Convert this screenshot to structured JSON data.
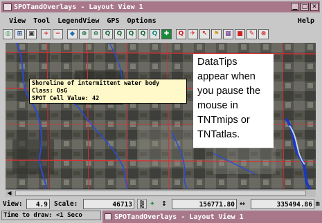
{
  "window": {
    "title": "SPOTandOverlays - Layout View 1",
    "controls": [
      "minimize",
      "maximize",
      "close"
    ]
  },
  "menu": {
    "items": [
      "View",
      "Tool",
      "LegendView",
      "GPS",
      "Options"
    ],
    "help": "Help"
  },
  "toolbar": {
    "buttons": [
      "zoom-box-icon",
      "full-extent-icon",
      "overview-icon",
      "add-layer-icon",
      "remove-layer-icon",
      "select-icon",
      "zoom-in-icon",
      "zoom-out-icon",
      "zoom-box-icon",
      "zoom-1x-icon",
      "pan-icon",
      "redraw-icon",
      "datatip-icon",
      "measure-icon",
      "gps-icon",
      "draw-icon",
      "flag-icon",
      "legend-icon",
      "layer-control-icon",
      "tool-icon"
    ]
  },
  "datatip": {
    "line1": "Shoreline of intermittent water body",
    "line2": "Class: OsG",
    "line3": "SPOT Cell Value: 42"
  },
  "annotation": {
    "text": "DataTips appear when you pause the mouse in TNTmips or TNTatlas."
  },
  "status": {
    "view_label": "View:",
    "view_value": "4.9",
    "scale_label": "Scale:",
    "scale_value": "46713",
    "y_coord": "156771.80",
    "x_coord": "335494.86",
    "unit": "m"
  },
  "time_to_draw": "Time to draw: <1 Seco",
  "taskbar": {
    "title": "SPOTandOverlays - Layout View 1"
  },
  "colors": {
    "titlebar": "#a8788a",
    "datatip_bg": "#fff8c8",
    "stream": "#2a4cd0",
    "road": "#d83030"
  }
}
